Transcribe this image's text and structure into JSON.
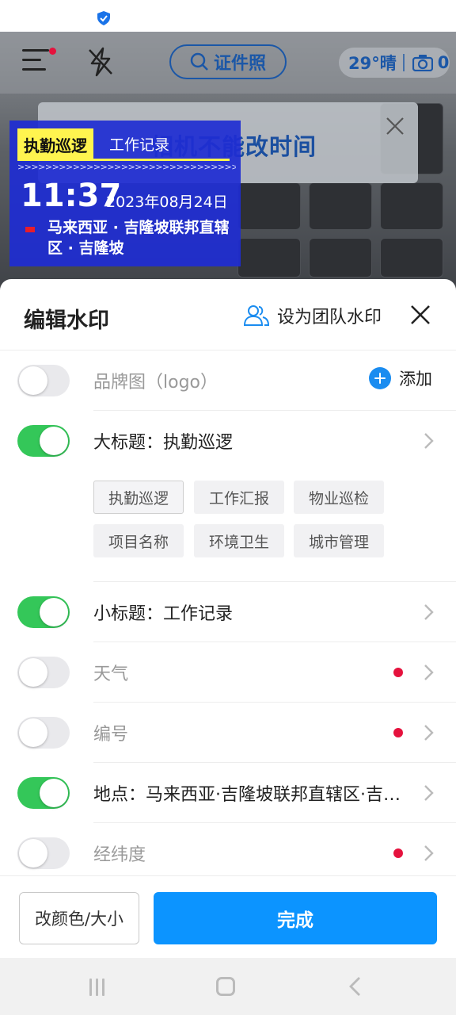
{
  "camera": {
    "search_label": "证件照",
    "weather": "29°晴",
    "photo_count": "0",
    "tip_text": "相机不能改时间"
  },
  "watermark": {
    "title": "执勤巡逻",
    "subtitle": "工作记录",
    "arrows": ">>>>>>>>>>>>>>>>>>>>>>>>>>>>>>>>>>>>>",
    "time": "11:37",
    "date": "2023年08月24日",
    "location": "马来西亚 · 吉隆坡联邦直辖区 · 吉隆坡"
  },
  "sheet": {
    "title": "编辑水印",
    "team_label": "设为团队水印",
    "add_label": "添加",
    "rows": [
      {
        "label": "品牌图（logo）",
        "on": false
      },
      {
        "label": "大标题：执勤巡逻",
        "on": true
      },
      {
        "label": "小标题：工作记录",
        "on": true
      },
      {
        "label": "天气",
        "on": false
      },
      {
        "label": "编号",
        "on": false
      },
      {
        "label": "地点：马来西亚·吉隆坡联邦直辖区·吉隆坡",
        "on": true
      },
      {
        "label": "经纬度",
        "on": false
      }
    ],
    "chips": [
      "执勤巡逻",
      "工作汇报",
      "物业巡检",
      "项目名称",
      "环境卫生",
      "城市管理"
    ],
    "color_label": "改颜色/大小",
    "done_label": "完成"
  },
  "colors": {
    "accent": "#0c94ff",
    "toggle_on": "#34c759",
    "watermark_bg": "#1e2dd2",
    "watermark_title_bg": "#fff44f",
    "new_dot": "#e5123d"
  }
}
